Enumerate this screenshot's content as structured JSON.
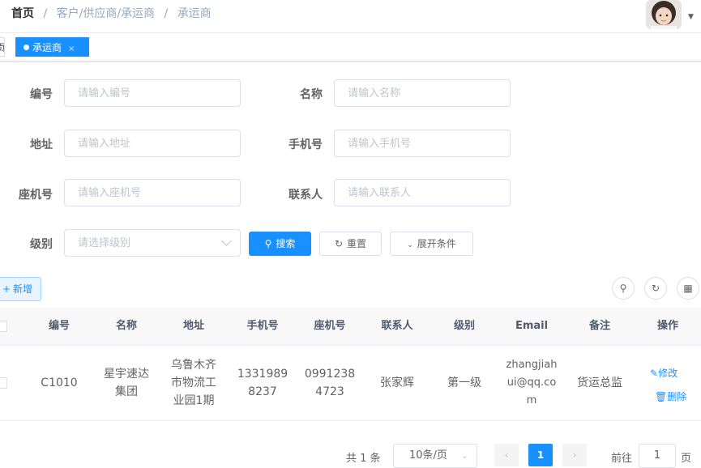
{
  "breadcrumb": {
    "home": "首页",
    "sep1": "/",
    "parent": "客户/供应商/承运商",
    "sep2": "/",
    "current": "承运商"
  },
  "tags": {
    "home_fragment": "页",
    "active": "承运商",
    "close": "×"
  },
  "form": {
    "fields": [
      {
        "label": "编号",
        "placeholder": "请输入编号"
      },
      {
        "label": "名称",
        "placeholder": "请输入名称"
      },
      {
        "label": "地址",
        "placeholder": "请输入地址"
      },
      {
        "label": "手机号",
        "placeholder": "请输入手机号"
      },
      {
        "label": "座机号",
        "placeholder": "请输入座机号"
      },
      {
        "label": "联系人",
        "placeholder": "请输入联系人"
      }
    ],
    "level": {
      "label": "级别",
      "placeholder": "请选择级别"
    },
    "buttons": {
      "search": "搜索",
      "reset": "重置",
      "expand": "展开条件"
    }
  },
  "toolbar": {
    "add": "新增"
  },
  "table": {
    "columns": [
      "编号",
      "名称",
      "地址",
      "手机号",
      "座机号",
      "联系人",
      "级别",
      "Email",
      "备注",
      "操作"
    ],
    "rows": [
      {
        "code": "C1010",
        "name_l1": "星宇速达",
        "name_l2": "集团",
        "addr_l1": "乌鲁木齐",
        "addr_l2": "市物流工",
        "addr_l3": "业园1期",
        "mobile_l1": "1331989",
        "mobile_l2": "8237",
        "phone_l1": "0991238",
        "phone_l2": "4723",
        "contact": "张家辉",
        "level": "第一级",
        "email_l1": "zhangjiah",
        "email_l2": "ui@qq.co",
        "email_l3": "m",
        "remark": "货运总监",
        "edit": "修改",
        "del": "删除"
      }
    ]
  },
  "pagination": {
    "total": "共 1 条",
    "page_size": "10条/页",
    "current_page": "1",
    "goto_prefix": "前往",
    "goto_value": "1",
    "goto_suffix": "页"
  },
  "colors": {
    "primary": "#1890ff",
    "header_bg": "#f8f8f9",
    "border": "#dcdfe6"
  }
}
